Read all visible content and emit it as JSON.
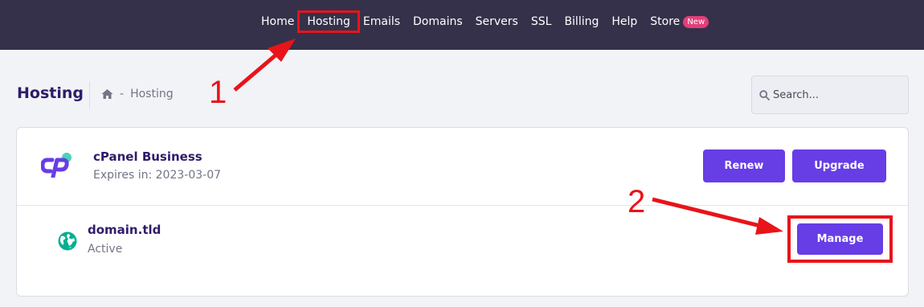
{
  "nav": {
    "items": [
      {
        "label": "Home"
      },
      {
        "label": "Hosting"
      },
      {
        "label": "Emails"
      },
      {
        "label": "Domains"
      },
      {
        "label": "Servers"
      },
      {
        "label": "SSL"
      },
      {
        "label": "Billing"
      },
      {
        "label": "Help"
      },
      {
        "label": "Store"
      }
    ],
    "store_badge": "New",
    "active_item": "Hosting"
  },
  "header": {
    "title": "Hosting",
    "breadcrumb": {
      "separator": "-",
      "current": "Hosting"
    }
  },
  "search": {
    "placeholder": "Search..."
  },
  "plan": {
    "name": "cPanel Business",
    "expires": "Expires in: 2023-03-07",
    "renew_label": "Renew",
    "upgrade_label": "Upgrade"
  },
  "domain": {
    "name": "domain.tld",
    "status": "Active",
    "manage_label": "Manage"
  },
  "annotations": {
    "step1": "1",
    "step2": "2"
  },
  "colors": {
    "nav_bg": "#35314a",
    "primary": "#673de6",
    "annotation": "#e8141a",
    "badge": "#e43e7a",
    "globe": "#00b090"
  },
  "icons": [
    "home-icon",
    "search-icon",
    "cpanel-logo",
    "globe-icon"
  ]
}
